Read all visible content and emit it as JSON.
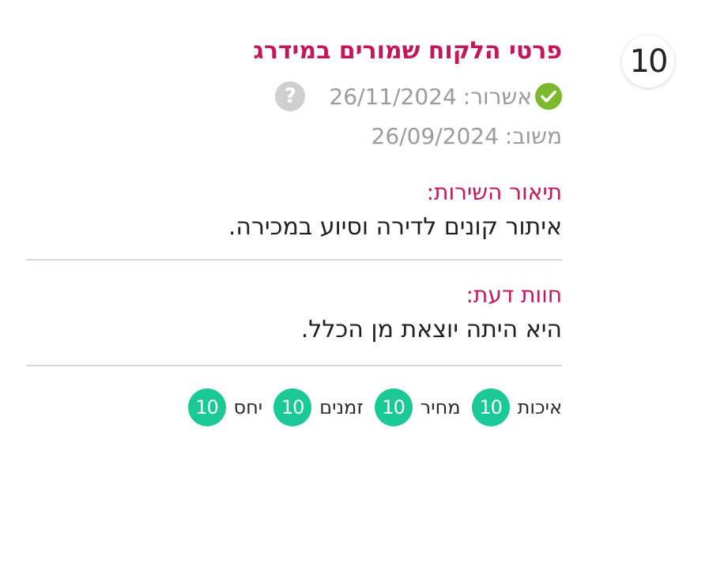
{
  "colors": {
    "accent": "#c2185b",
    "muted_text": "#9b9b9b",
    "rating_green": "#1bc996",
    "check_green": "#7cb82f",
    "help_grey": "#cfcfcf"
  },
  "review": {
    "score": "10",
    "title": "פרטי הלקוח שמורים במידרג",
    "approval": {
      "label": "אשרור:",
      "date": "26/11/2024",
      "status_icon": "check-circle-icon",
      "help_icon": "question-circle-icon",
      "help_symbol": "?"
    },
    "response": {
      "label": "משוב:",
      "date": "26/09/2024"
    },
    "service": {
      "label": "תיאור השירות:",
      "text": "איתור קונים לדירה וסיוע במכירה."
    },
    "opinion": {
      "label": "חוות דעת:",
      "text": "היא היתה יוצאת מן הכלל."
    },
    "ratings": [
      {
        "label": "איכות",
        "value": "10"
      },
      {
        "label": "מחיר",
        "value": "10"
      },
      {
        "label": "זמנים",
        "value": "10"
      },
      {
        "label": "יחס",
        "value": "10"
      }
    ]
  }
}
